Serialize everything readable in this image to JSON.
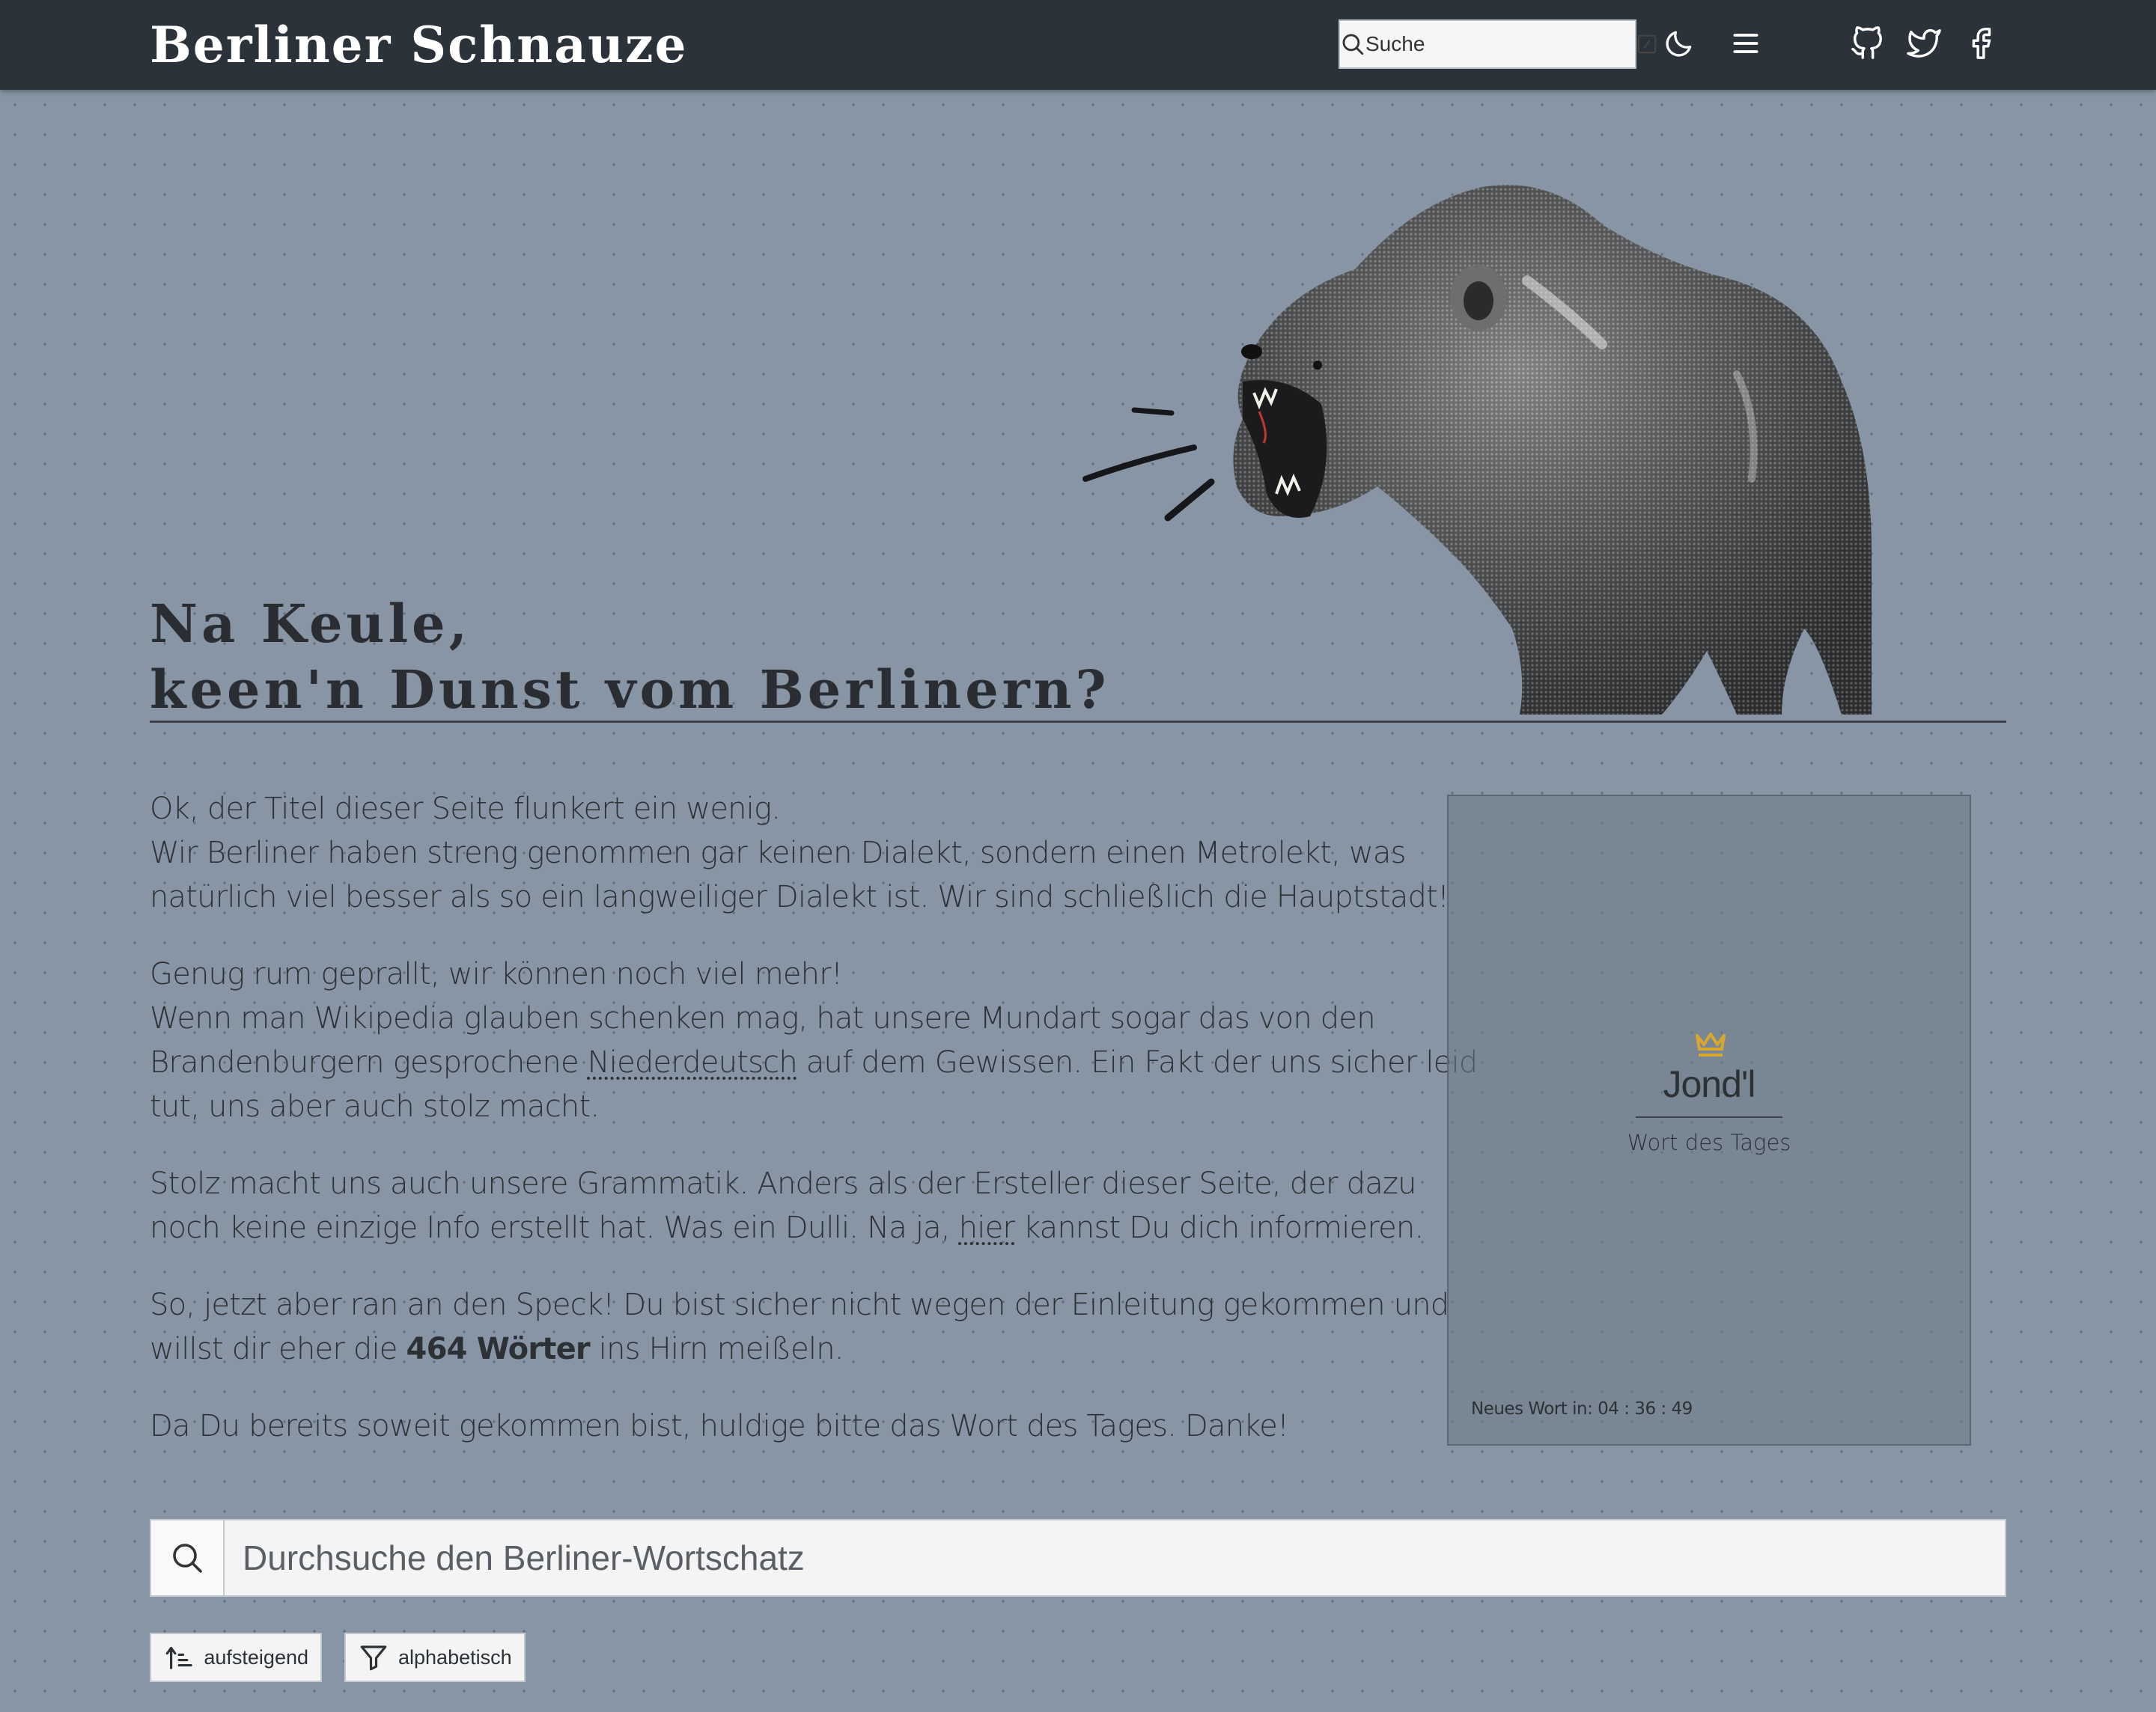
{
  "navbar": {
    "brand": "Berliner Schnauze",
    "search_placeholder": "Suche",
    "icons": [
      "search-icon",
      "keyboard-shortcut-icon",
      "moon-icon",
      "menu-icon",
      "github-icon",
      "twitter-icon",
      "facebook-icon"
    ]
  },
  "hero": {
    "title_line1": "Na Keule,",
    "title_line2": "keen'n Dunst vom Berlinern?",
    "image": "roaring-bear"
  },
  "intro": {
    "p1_l1": "Ok, der Titel dieser Seite flunkert ein wenig.",
    "p1_l2": "Wir Berliner haben streng genommen gar keinen Dialekt, sondern einen Metrolekt, was",
    "p1_l3": "natürlich viel besser als so ein langweiliger Dialekt ist. Wir sind schließlich die Hauptstadt!",
    "p2_l1": "Genug rum geprallt, wir können noch viel mehr!",
    "p2_l2": "Wenn man Wikipedia glauben schenken mag, hat unsere Mundart sogar das von den",
    "p2_l3_pre": "Brandenburgern gesprochene ",
    "p2_l3_link": "Niederdeutsch",
    "p2_l3_post": " auf dem Gewissen. Ein Fakt der uns sicher leid",
    "p2_l4": "tut, uns aber auch stolz macht.",
    "p3_l1": "Stolz macht uns auch unsere Grammatik. Anders als der Ersteller dieser Seite, der dazu",
    "p3_l2_pre": "noch keine einzige Info erstellt hat. Was ein Dulli. Na ja, ",
    "p3_l2_link": "hier",
    "p3_l2_post": " kannst Du dich informieren.",
    "p4_l1": "So, jetzt aber ran an den Speck! Du bist sicher nicht wegen der Einleitung gekommen und",
    "p4_l2_pre": "willst dir eher die ",
    "p4_l2_bold": "464 Wörter",
    "p4_l2_post": " ins Hirn meißeln.",
    "p5_l1": "Da Du bereits soweit gekommen bist, huldige bitte das Wort des Tages. Danke!"
  },
  "word_of_day": {
    "word": "Jond'l",
    "label": "Wort des Tages",
    "countdown_label": "Neues Wort in:",
    "countdown": "04 : 36 : 49",
    "accent": "#d9a730"
  },
  "search": {
    "placeholder": "Durchsuche den Berliner-Wortschatz"
  },
  "sort": {
    "order_label": "aufsteigend",
    "filter_label": "alphabetisch"
  }
}
